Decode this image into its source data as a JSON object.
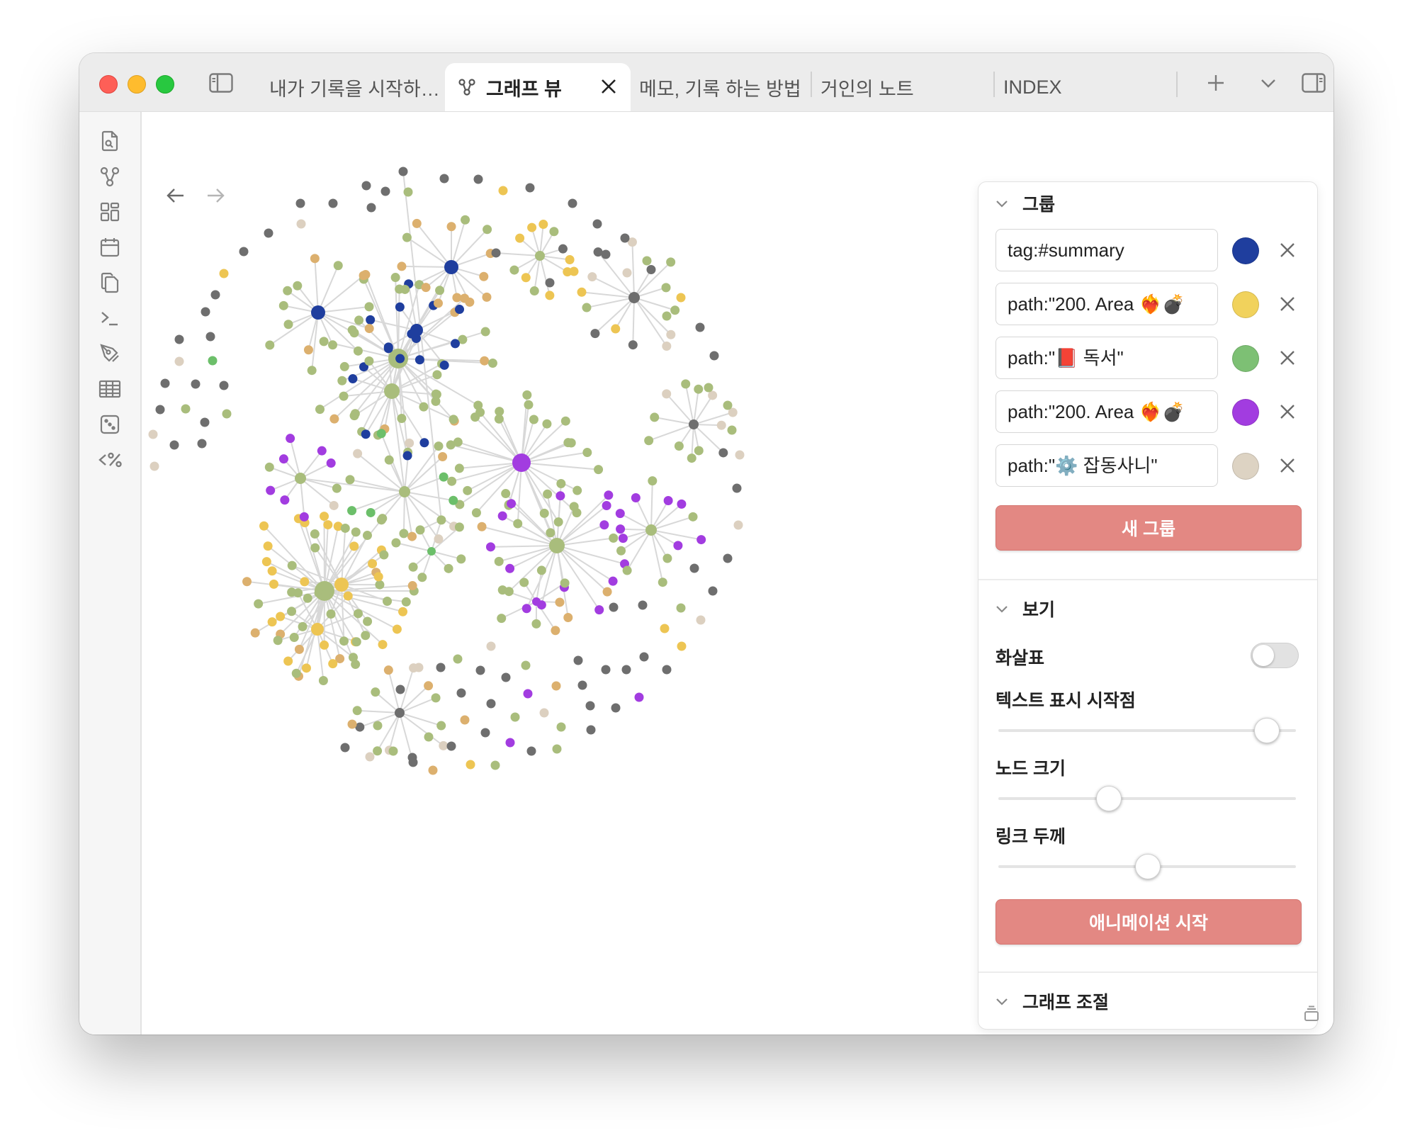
{
  "tabs": [
    {
      "label": "내가 기록을 시작하…",
      "active": false
    },
    {
      "label": "그래프 뷰",
      "active": true
    },
    {
      "label": "메모, 기록 하는 방법",
      "active": false
    },
    {
      "label": "거인의 노트",
      "active": false
    },
    {
      "label": "INDEX",
      "active": false
    }
  ],
  "colors": {
    "accent": "#e38883",
    "node_default": "#a9bd7c",
    "node_gray": "#6e6e6e",
    "node_summary": "#1f3e9e",
    "node_area": "#edc553",
    "node_reading": "#6cbf6a",
    "node_area2": "#a23ce0",
    "node_misc": "#dcd0c0",
    "node_orange": "#dcb06e",
    "link": "#d8d8d8"
  },
  "groups_section": {
    "title": "그룹",
    "queries": [
      {
        "query": "tag:#summary",
        "color": "#1f3e9e"
      },
      {
        "query": "path:\"200. Area ❤️‍🔥💣",
        "color": "#f1d25c"
      },
      {
        "query": "path:\"📕 독서\"",
        "color": "#7dc074"
      },
      {
        "query": "path:\"200. Area ❤️‍🔥💣",
        "color": "#a23ce0"
      },
      {
        "query": "path:\"⚙️ 잡동사니\"",
        "color": "#ddd3c3"
      }
    ],
    "new_group_label": "새 그룹"
  },
  "display_section": {
    "title": "보기",
    "arrows_label": "화살표",
    "arrows_enabled": false,
    "text_fade_label": "텍스트 표시 시작점",
    "text_fade_value": 0.9,
    "node_size_label": "노드 크기",
    "node_size_value": 0.37,
    "link_thickness_label": "링크 두께",
    "link_thickness_value": 0.5,
    "animate_label": "애니메이션 시작"
  },
  "forces_section": {
    "title": "그래프 조절"
  }
}
